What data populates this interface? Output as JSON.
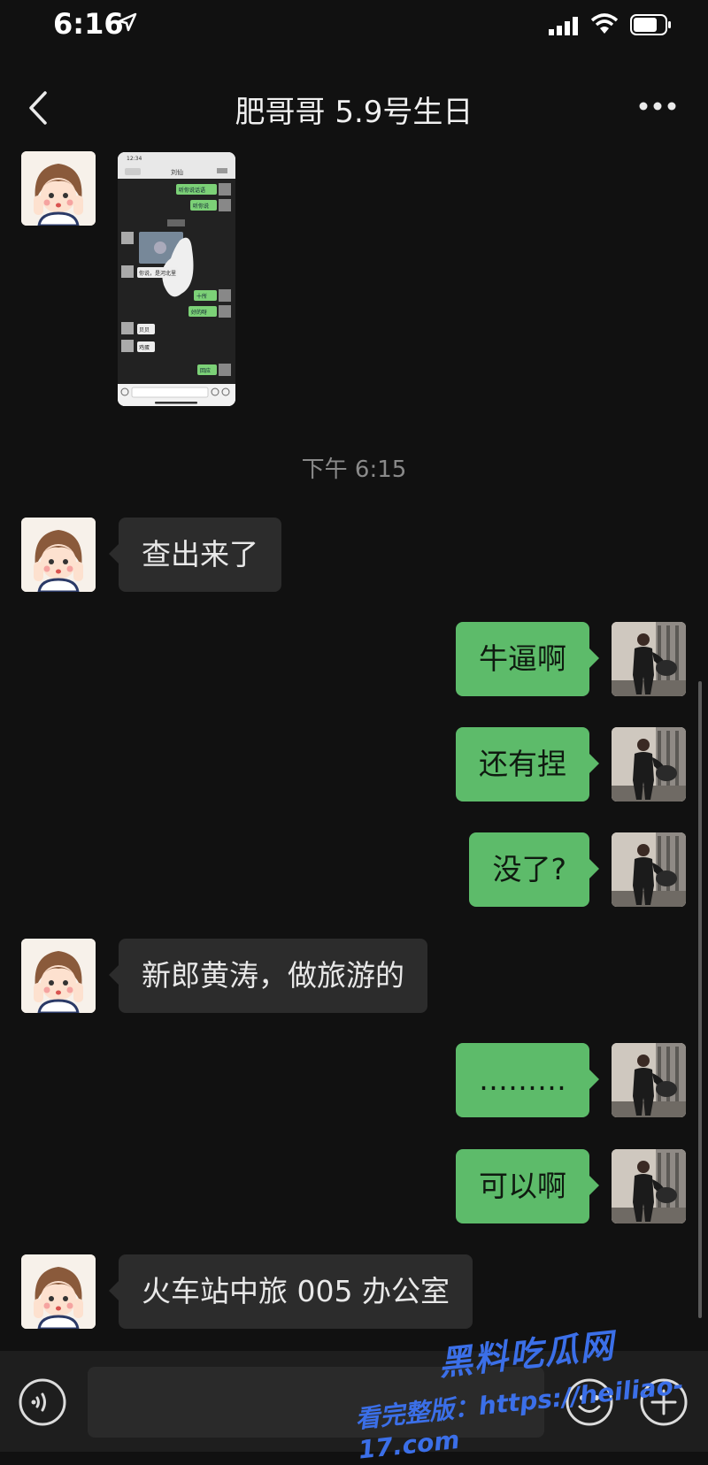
{
  "status_bar": {
    "time": "6:16"
  },
  "header": {
    "title": "肥哥哥 5.9号生日"
  },
  "timestamp": "下午 6:15",
  "messages": [
    {
      "side": "in",
      "type": "image"
    },
    {
      "side": "in",
      "text": "查出来了"
    },
    {
      "side": "out",
      "text": "牛逼啊"
    },
    {
      "side": "out",
      "text": "还有捏"
    },
    {
      "side": "out",
      "text": "没了?"
    },
    {
      "side": "in",
      "text": "新郎黄涛，做旅游的"
    },
    {
      "side": "out",
      "text": "………"
    },
    {
      "side": "out",
      "text": "可以啊"
    },
    {
      "side": "in",
      "text": "火车站中旅 005 办公室"
    }
  ],
  "screenshot_thumb": {
    "time": "12:34",
    "title": "刘仙",
    "left_texts": [
      "你说，是河北里",
      "贝贝",
      "鸡蛋"
    ],
    "right_texts": [
      "听你说话语",
      "听你说",
      "十所",
      "好的呀",
      "回应"
    ]
  },
  "watermark": {
    "brand": "黑料吃瓜网",
    "url": "https://heiliao-17.com",
    "full_label": "看完整版：https://heiliao-17.com"
  },
  "colors": {
    "background": "#111111",
    "sent_bubble": "#5dbb6a",
    "received_bubble": "#2c2c2c",
    "watermark": "#3b6fe8"
  },
  "icons": [
    "location-arrow-icon",
    "cellular-signal-icon",
    "wifi-icon",
    "battery-icon",
    "back-chevron-icon",
    "more-dots-icon",
    "voice-icon",
    "emoji-icon",
    "plus-icon"
  ]
}
